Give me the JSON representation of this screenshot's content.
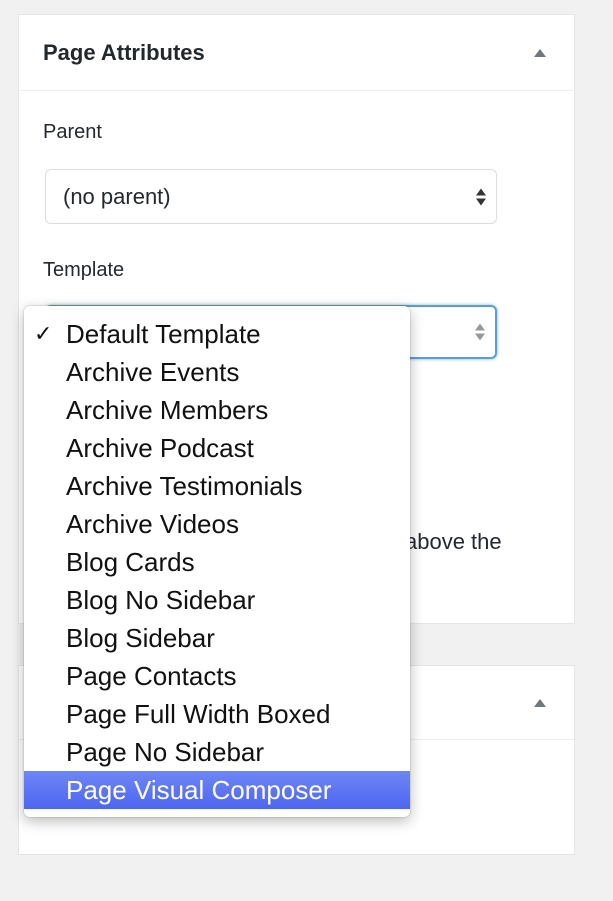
{
  "page_attributes": {
    "title": "Page Attributes",
    "parent_label": "Parent",
    "parent_value": "(no parent)",
    "template_label": "Template",
    "hint_tail": "above the"
  },
  "template_menu": {
    "checked_index": 0,
    "highlighted_index": 12,
    "options": [
      "Default Template",
      "Archive Events",
      "Archive Members",
      "Archive Podcast",
      "Archive Testimonials",
      "Archive Videos",
      "Blog Cards",
      "Blog No Sidebar",
      "Blog Sidebar",
      "Page Contacts",
      "Page Full Width Boxed",
      "Page No Sidebar",
      "Page Visual Composer"
    ]
  },
  "colors": {
    "highlight": "#5069f0",
    "focus_ring": "#5b9dd9"
  },
  "icons": {
    "collapse": "triangle-up",
    "select_arrows": "up-down-arrows",
    "check": "checkmark"
  }
}
